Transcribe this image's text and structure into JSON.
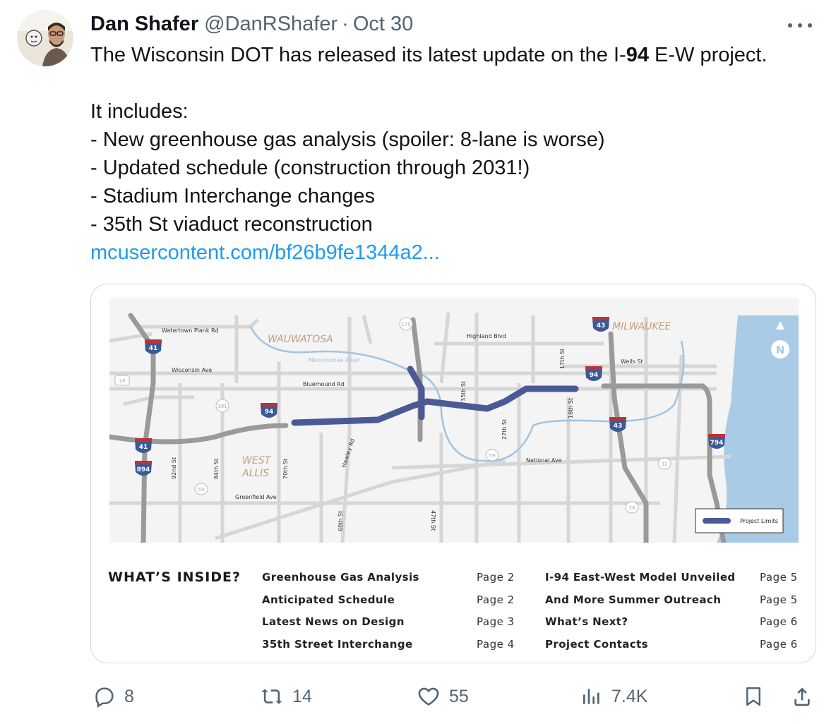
{
  "tweet": {
    "author_name": "Dan Shafer",
    "author_handle": "@DanRShafer",
    "separator": "·",
    "date": "Oct 30",
    "text_line1_pre": "The Wisconsin DOT has released its latest update on the I-",
    "text_line1_bold": "94",
    "text_line1_post": " E-W project.",
    "intro": "It includes:",
    "bullets": [
      "- New greenhouse gas analysis (spoiler: 8-lane is worse)",
      "- Updated schedule (construction through 2031!)",
      "- Stadium Interchange changes",
      "- 35th St viaduct reconstruction"
    ],
    "link_text": "mcusercontent.com/bf26b9fe1344a2..."
  },
  "map": {
    "place_labels": {
      "wauwatosa": "WAUWATOSA",
      "milwaukee": "MILWAUKEE",
      "west": "WEST",
      "allis": "ALLIS"
    },
    "street_labels": {
      "watertown": "Watertown Plank Rd",
      "wisconsin": "Wisconsin Ave",
      "bluemound": "Bluemound Rd",
      "highland": "Highland Blvd",
      "wells": "Wells St",
      "national": "National Ave",
      "greenfield": "Greenfield Ave",
      "menomonee": "Menomonee River",
      "st92": "92nd St",
      "st84": "84th St",
      "st70": "70th St",
      "hawley": "Hawley Rd",
      "st60": "60th St",
      "st35": "35th St",
      "st27": "27th St",
      "st17": "17th St",
      "st16": "16th St",
      "st47": "47th St"
    },
    "shields": {
      "i41_top": "41",
      "i41_bottom": "41",
      "i894": "894",
      "i94_west": "94",
      "i94_east": "94",
      "i43_top": "43",
      "i43_bottom": "43",
      "i794": "794",
      "wi175": "175",
      "us18": "18",
      "wi181": "181",
      "wi59_west": "59",
      "wi59_east": "59",
      "wi32": "32",
      "wi38": "38"
    },
    "north_label": "N",
    "legend_label": "Project Limits",
    "colors": {
      "project": "#4b5a96",
      "river": "#9fc4e3",
      "lake": "#a9cbe6",
      "freeway": "#9a9a9a",
      "street": "#d6d6d6",
      "place_label": "#c4a07c"
    }
  },
  "inside": {
    "title": "WHAT’S INSIDE?",
    "items": [
      {
        "label": "Greenhouse Gas Analysis",
        "page": "Page 2"
      },
      {
        "label": "Anticipated Schedule",
        "page": "Page 2"
      },
      {
        "label": "Latest News on Design",
        "page": "Page 3"
      },
      {
        "label": "35th Street Interchange",
        "page": "Page 4"
      },
      {
        "label": "I-94 East-West Model Unveiled",
        "page": "Page 5"
      },
      {
        "label": "And More Summer Outreach",
        "page": "Page 5"
      },
      {
        "label": "What’s Next?",
        "page": "Page 6"
      },
      {
        "label": "Project Contacts",
        "page": "Page 6"
      }
    ]
  },
  "actions": {
    "replies": "8",
    "retweets": "14",
    "likes": "55",
    "views": "7.4K",
    "icons": [
      "reply-icon",
      "retweet-icon",
      "like-icon",
      "views-icon",
      "bookmark-icon",
      "share-icon"
    ]
  }
}
